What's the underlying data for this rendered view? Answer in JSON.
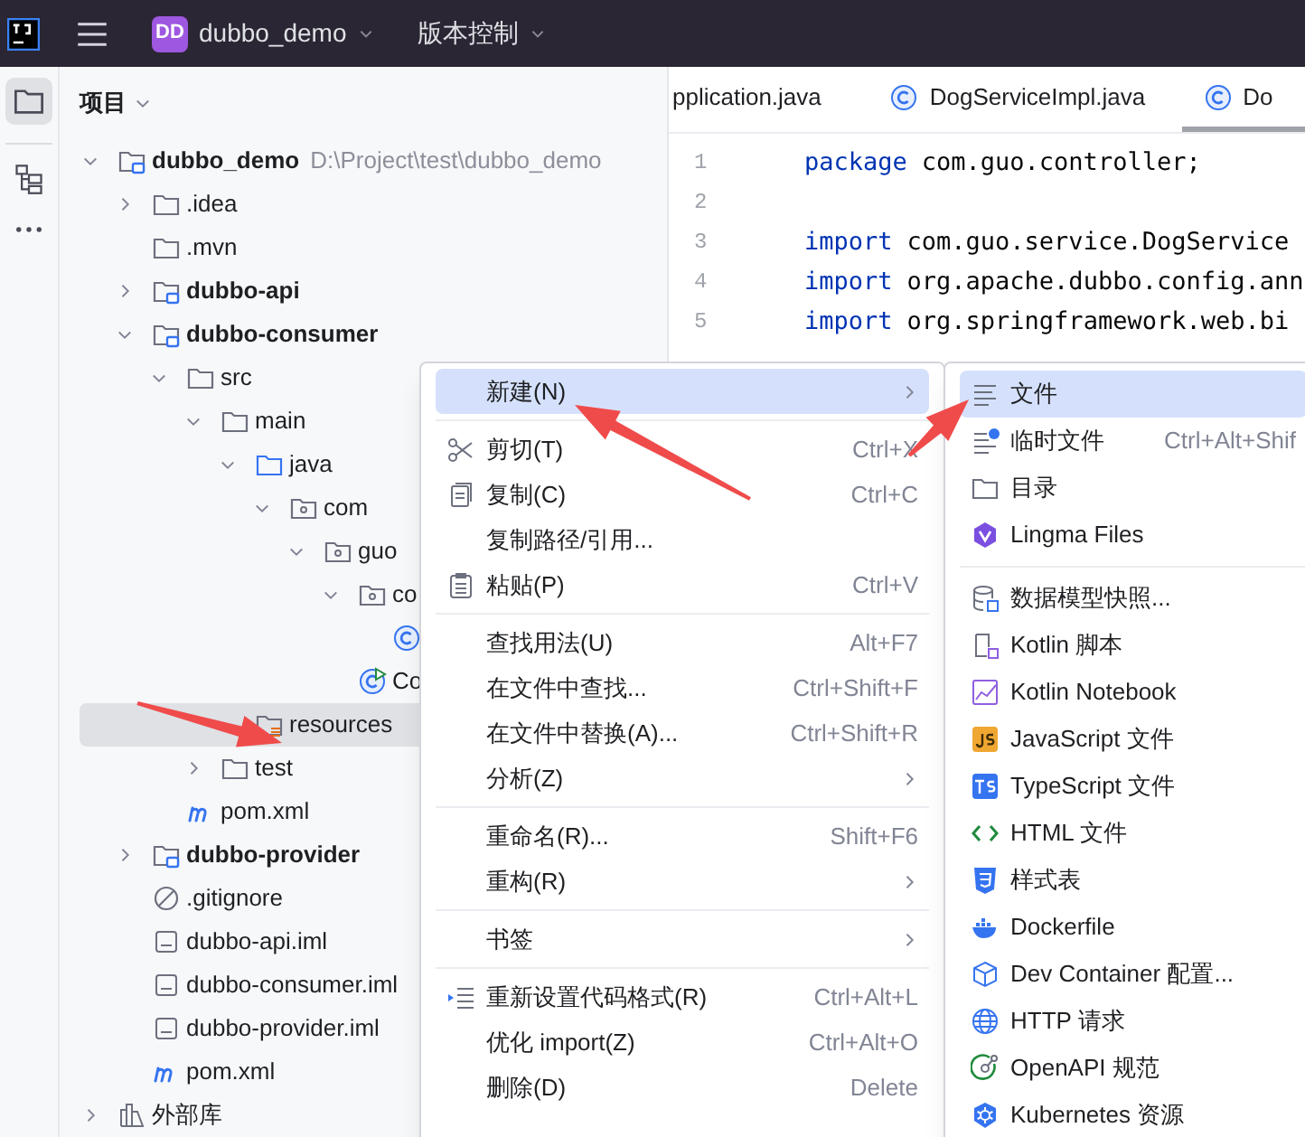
{
  "top_bar": {
    "project_badge": "DD",
    "project_name": "dubbo_demo",
    "vcs_menu": "版本控制"
  },
  "project_panel": {
    "title": "项目",
    "tree": [
      {
        "label": "dubbo_demo",
        "path": "D:\\Project\\test\\dubbo_demo",
        "kind": "module",
        "expanded": true,
        "selected": false,
        "children": [
          {
            "label": ".idea",
            "kind": "folder",
            "expanded": false,
            "selected": false
          },
          {
            "label": ".mvn",
            "kind": "folder",
            "selected": false
          },
          {
            "label": "dubbo-api",
            "kind": "module",
            "expanded": false,
            "selected": false
          },
          {
            "label": "dubbo-consumer",
            "kind": "module",
            "expanded": true,
            "selected": false,
            "children": [
              {
                "label": "src",
                "kind": "folder",
                "expanded": true,
                "selected": false,
                "children": [
                  {
                    "label": "main",
                    "kind": "folder",
                    "expanded": true,
                    "selected": false,
                    "children": [
                      {
                        "label": "java",
                        "kind": "source-folder",
                        "expanded": true,
                        "selected": false,
                        "children": [
                          {
                            "label": "com",
                            "kind": "package",
                            "expanded": true,
                            "selected": false,
                            "children": [
                              {
                                "label": "guo",
                                "kind": "package",
                                "expanded": true,
                                "selected": false,
                                "children": [
                                  {
                                    "label": "co",
                                    "kind": "package",
                                    "expanded": true,
                                    "selected": false,
                                    "children": [
                                      {
                                        "kind": "class",
                                        "selected": false
                                      }
                                    ]
                                  },
                                  {
                                    "label": "Co",
                                    "kind": "main-class",
                                    "selected": false
                                  }
                                ]
                              }
                            ]
                          }
                        ]
                      },
                      {
                        "label": "resources",
                        "kind": "resources-folder",
                        "selected": true
                      }
                    ]
                  },
                  {
                    "label": "test",
                    "kind": "folder",
                    "expanded": false,
                    "selected": false
                  }
                ]
              },
              {
                "label": "pom.xml",
                "kind": "maven",
                "selected": false
              }
            ]
          },
          {
            "label": "dubbo-provider",
            "kind": "module",
            "expanded": false,
            "selected": false
          },
          {
            "label": ".gitignore",
            "kind": "ignore",
            "selected": false
          },
          {
            "label": "dubbo-api.iml",
            "kind": "iml",
            "selected": false
          },
          {
            "label": "dubbo-consumer.iml",
            "kind": "iml",
            "selected": false
          },
          {
            "label": "dubbo-provider.iml",
            "kind": "iml",
            "selected": false
          },
          {
            "label": "pom.xml",
            "kind": "maven",
            "selected": false
          }
        ]
      },
      {
        "label": "外部库",
        "kind": "library",
        "expanded": false,
        "selected": false
      }
    ]
  },
  "editor": {
    "tabs": [
      {
        "label": "pplication.java",
        "kind": "plain",
        "selected": false
      },
      {
        "label": "DogServiceImpl.java",
        "kind": "class",
        "selected": false
      },
      {
        "label": "Do",
        "kind": "class",
        "selected": true
      }
    ],
    "lines": [
      {
        "number": "1",
        "keyword": "package",
        "text": "com.guo.controller;"
      },
      {
        "number": "2"
      },
      {
        "number": "3",
        "keyword": "import",
        "text": "com.guo.service.DogService"
      },
      {
        "number": "4",
        "keyword": "import",
        "text": "org.apache.dubbo.config.ann"
      },
      {
        "number": "5",
        "keyword": "import",
        "text": "org.springframework.web.bi"
      }
    ]
  },
  "context_menu": {
    "groups": [
      [
        {
          "label": "新建(N)",
          "kind": "plain",
          "submenu": true,
          "selected": true
        }
      ],
      [
        {
          "label": "剪切(T)",
          "kind": "cut",
          "shortcut": "Ctrl+X",
          "selected": false
        },
        {
          "label": "复制(C)",
          "kind": "copy",
          "shortcut": "Ctrl+C",
          "selected": false
        },
        {
          "label": "复制路径/引用...",
          "kind": "plain",
          "selected": false
        },
        {
          "label": "粘贴(P)",
          "kind": "paste",
          "shortcut": "Ctrl+V",
          "selected": false
        }
      ],
      [
        {
          "label": "查找用法(U)",
          "kind": "plain",
          "shortcut": "Alt+F7",
          "selected": false
        },
        {
          "label": "在文件中查找...",
          "kind": "plain",
          "shortcut": "Ctrl+Shift+F",
          "selected": false
        },
        {
          "label": "在文件中替换(A)...",
          "kind": "plain",
          "shortcut": "Ctrl+Shift+R",
          "selected": false
        },
        {
          "label": "分析(Z)",
          "kind": "plain",
          "submenu": true,
          "selected": false
        }
      ],
      [
        {
          "label": "重命名(R)...",
          "kind": "plain",
          "shortcut": "Shift+F6",
          "selected": false
        },
        {
          "label": "重构(R)",
          "kind": "plain",
          "submenu": true,
          "selected": false
        }
      ],
      [
        {
          "label": "书签",
          "kind": "plain",
          "submenu": true,
          "selected": false
        }
      ],
      [
        {
          "label": "重新设置代码格式(R)",
          "kind": "reformat",
          "shortcut": "Ctrl+Alt+L",
          "selected": false
        },
        {
          "label": "优化 import(Z)",
          "kind": "plain",
          "shortcut": "Ctrl+Alt+O",
          "selected": false
        },
        {
          "label": "删除(D)",
          "kind": "plain",
          "shortcut": "Delete",
          "selected": false
        }
      ]
    ]
  },
  "new_submenu": {
    "groups": [
      [
        {
          "label": "文件",
          "kind": "file",
          "selected": true
        },
        {
          "label": "临时文件",
          "kind": "scratch",
          "shortcut": "Ctrl+Alt+Shif",
          "selected": false
        },
        {
          "label": "目录",
          "kind": "folder",
          "selected": false
        },
        {
          "label": "Lingma Files",
          "kind": "lingma",
          "selected": false
        }
      ],
      [
        {
          "label": "数据模型快照...",
          "kind": "database",
          "selected": false
        },
        {
          "label": "Kotlin 脚本",
          "kind": "kotlin-script",
          "selected": false
        },
        {
          "label": "Kotlin Notebook",
          "kind": "notebook",
          "selected": false
        },
        {
          "label": "JavaScript 文件",
          "kind": "js",
          "selected": false
        },
        {
          "label": "TypeScript 文件",
          "kind": "ts",
          "selected": false
        },
        {
          "label": "HTML 文件",
          "kind": "html",
          "selected": false
        },
        {
          "label": "样式表",
          "kind": "css",
          "selected": false
        },
        {
          "label": "Dockerfile",
          "kind": "docker",
          "selected": false
        },
        {
          "label": "Dev Container 配置...",
          "kind": "container",
          "selected": false
        },
        {
          "label": "HTTP 请求",
          "kind": "http",
          "selected": false
        },
        {
          "label": "OpenAPI 规范",
          "kind": "openapi",
          "selected": false
        },
        {
          "label": "Kubernetes 资源",
          "kind": "kubernetes",
          "selected": false
        }
      ]
    ]
  }
}
